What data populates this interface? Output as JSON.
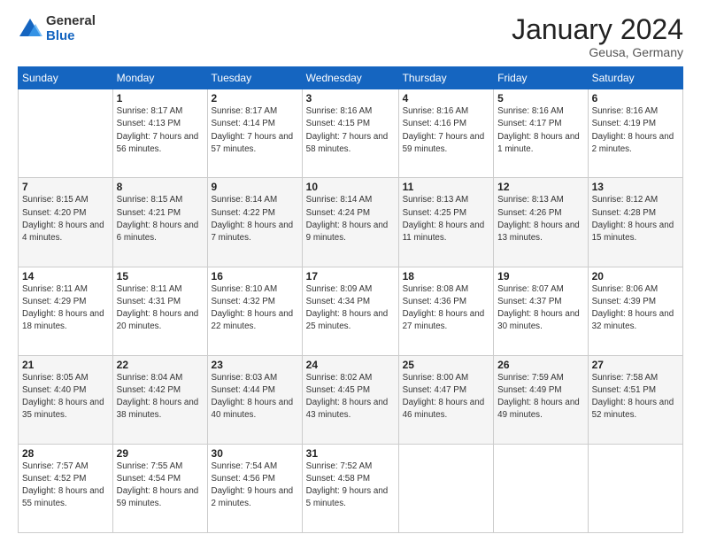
{
  "logo": {
    "general": "General",
    "blue": "Blue"
  },
  "header": {
    "month": "January 2024",
    "location": "Geusa, Germany"
  },
  "weekdays": [
    "Sunday",
    "Monday",
    "Tuesday",
    "Wednesday",
    "Thursday",
    "Friday",
    "Saturday"
  ],
  "weeks": [
    [
      {
        "day": "",
        "sunrise": "",
        "sunset": "",
        "daylight": ""
      },
      {
        "day": "1",
        "sunrise": "Sunrise: 8:17 AM",
        "sunset": "Sunset: 4:13 PM",
        "daylight": "Daylight: 7 hours and 56 minutes."
      },
      {
        "day": "2",
        "sunrise": "Sunrise: 8:17 AM",
        "sunset": "Sunset: 4:14 PM",
        "daylight": "Daylight: 7 hours and 57 minutes."
      },
      {
        "day": "3",
        "sunrise": "Sunrise: 8:16 AM",
        "sunset": "Sunset: 4:15 PM",
        "daylight": "Daylight: 7 hours and 58 minutes."
      },
      {
        "day": "4",
        "sunrise": "Sunrise: 8:16 AM",
        "sunset": "Sunset: 4:16 PM",
        "daylight": "Daylight: 7 hours and 59 minutes."
      },
      {
        "day": "5",
        "sunrise": "Sunrise: 8:16 AM",
        "sunset": "Sunset: 4:17 PM",
        "daylight": "Daylight: 8 hours and 1 minute."
      },
      {
        "day": "6",
        "sunrise": "Sunrise: 8:16 AM",
        "sunset": "Sunset: 4:19 PM",
        "daylight": "Daylight: 8 hours and 2 minutes."
      }
    ],
    [
      {
        "day": "7",
        "sunrise": "Sunrise: 8:15 AM",
        "sunset": "Sunset: 4:20 PM",
        "daylight": "Daylight: 8 hours and 4 minutes."
      },
      {
        "day": "8",
        "sunrise": "Sunrise: 8:15 AM",
        "sunset": "Sunset: 4:21 PM",
        "daylight": "Daylight: 8 hours and 6 minutes."
      },
      {
        "day": "9",
        "sunrise": "Sunrise: 8:14 AM",
        "sunset": "Sunset: 4:22 PM",
        "daylight": "Daylight: 8 hours and 7 minutes."
      },
      {
        "day": "10",
        "sunrise": "Sunrise: 8:14 AM",
        "sunset": "Sunset: 4:24 PM",
        "daylight": "Daylight: 8 hours and 9 minutes."
      },
      {
        "day": "11",
        "sunrise": "Sunrise: 8:13 AM",
        "sunset": "Sunset: 4:25 PM",
        "daylight": "Daylight: 8 hours and 11 minutes."
      },
      {
        "day": "12",
        "sunrise": "Sunrise: 8:13 AM",
        "sunset": "Sunset: 4:26 PM",
        "daylight": "Daylight: 8 hours and 13 minutes."
      },
      {
        "day": "13",
        "sunrise": "Sunrise: 8:12 AM",
        "sunset": "Sunset: 4:28 PM",
        "daylight": "Daylight: 8 hours and 15 minutes."
      }
    ],
    [
      {
        "day": "14",
        "sunrise": "Sunrise: 8:11 AM",
        "sunset": "Sunset: 4:29 PM",
        "daylight": "Daylight: 8 hours and 18 minutes."
      },
      {
        "day": "15",
        "sunrise": "Sunrise: 8:11 AM",
        "sunset": "Sunset: 4:31 PM",
        "daylight": "Daylight: 8 hours and 20 minutes."
      },
      {
        "day": "16",
        "sunrise": "Sunrise: 8:10 AM",
        "sunset": "Sunset: 4:32 PM",
        "daylight": "Daylight: 8 hours and 22 minutes."
      },
      {
        "day": "17",
        "sunrise": "Sunrise: 8:09 AM",
        "sunset": "Sunset: 4:34 PM",
        "daylight": "Daylight: 8 hours and 25 minutes."
      },
      {
        "day": "18",
        "sunrise": "Sunrise: 8:08 AM",
        "sunset": "Sunset: 4:36 PM",
        "daylight": "Daylight: 8 hours and 27 minutes."
      },
      {
        "day": "19",
        "sunrise": "Sunrise: 8:07 AM",
        "sunset": "Sunset: 4:37 PM",
        "daylight": "Daylight: 8 hours and 30 minutes."
      },
      {
        "day": "20",
        "sunrise": "Sunrise: 8:06 AM",
        "sunset": "Sunset: 4:39 PM",
        "daylight": "Daylight: 8 hours and 32 minutes."
      }
    ],
    [
      {
        "day": "21",
        "sunrise": "Sunrise: 8:05 AM",
        "sunset": "Sunset: 4:40 PM",
        "daylight": "Daylight: 8 hours and 35 minutes."
      },
      {
        "day": "22",
        "sunrise": "Sunrise: 8:04 AM",
        "sunset": "Sunset: 4:42 PM",
        "daylight": "Daylight: 8 hours and 38 minutes."
      },
      {
        "day": "23",
        "sunrise": "Sunrise: 8:03 AM",
        "sunset": "Sunset: 4:44 PM",
        "daylight": "Daylight: 8 hours and 40 minutes."
      },
      {
        "day": "24",
        "sunrise": "Sunrise: 8:02 AM",
        "sunset": "Sunset: 4:45 PM",
        "daylight": "Daylight: 8 hours and 43 minutes."
      },
      {
        "day": "25",
        "sunrise": "Sunrise: 8:00 AM",
        "sunset": "Sunset: 4:47 PM",
        "daylight": "Daylight: 8 hours and 46 minutes."
      },
      {
        "day": "26",
        "sunrise": "Sunrise: 7:59 AM",
        "sunset": "Sunset: 4:49 PM",
        "daylight": "Daylight: 8 hours and 49 minutes."
      },
      {
        "day": "27",
        "sunrise": "Sunrise: 7:58 AM",
        "sunset": "Sunset: 4:51 PM",
        "daylight": "Daylight: 8 hours and 52 minutes."
      }
    ],
    [
      {
        "day": "28",
        "sunrise": "Sunrise: 7:57 AM",
        "sunset": "Sunset: 4:52 PM",
        "daylight": "Daylight: 8 hours and 55 minutes."
      },
      {
        "day": "29",
        "sunrise": "Sunrise: 7:55 AM",
        "sunset": "Sunset: 4:54 PM",
        "daylight": "Daylight: 8 hours and 59 minutes."
      },
      {
        "day": "30",
        "sunrise": "Sunrise: 7:54 AM",
        "sunset": "Sunset: 4:56 PM",
        "daylight": "Daylight: 9 hours and 2 minutes."
      },
      {
        "day": "31",
        "sunrise": "Sunrise: 7:52 AM",
        "sunset": "Sunset: 4:58 PM",
        "daylight": "Daylight: 9 hours and 5 minutes."
      },
      {
        "day": "",
        "sunrise": "",
        "sunset": "",
        "daylight": ""
      },
      {
        "day": "",
        "sunrise": "",
        "sunset": "",
        "daylight": ""
      },
      {
        "day": "",
        "sunrise": "",
        "sunset": "",
        "daylight": ""
      }
    ]
  ]
}
